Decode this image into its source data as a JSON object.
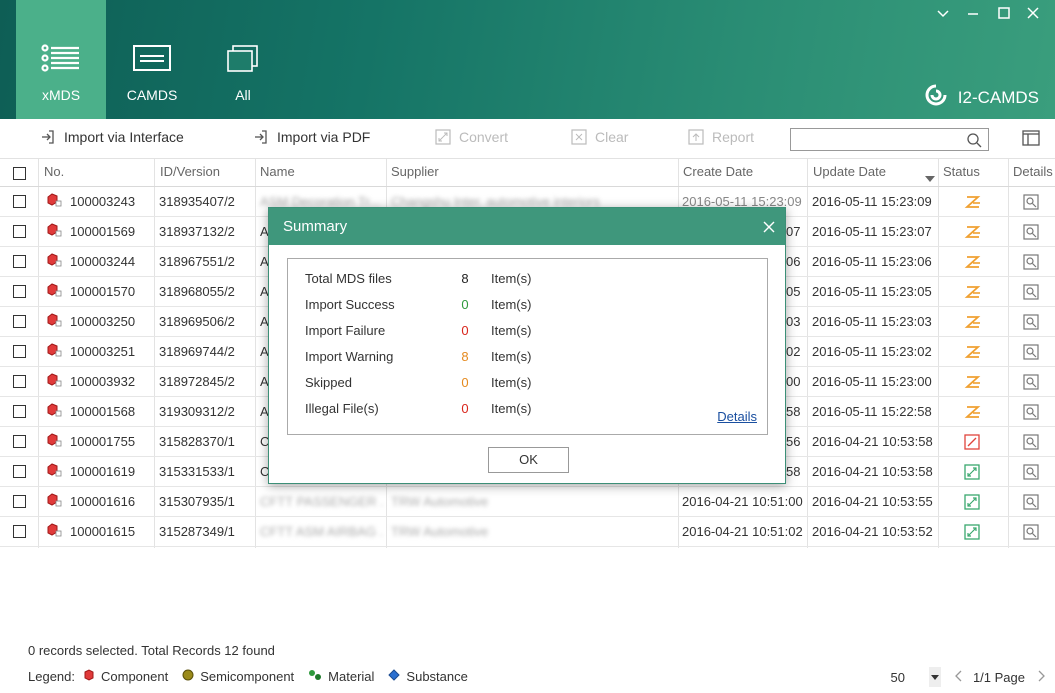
{
  "nav": {
    "tabs": [
      {
        "label": "xMDS",
        "active": true
      },
      {
        "label": "CAMDS",
        "active": false
      },
      {
        "label": "All",
        "active": false
      }
    ],
    "brand": "I2-CAMDS"
  },
  "toolbar": {
    "import_interface": "Import via Interface",
    "import_pdf": "Import via PDF",
    "convert": "Convert",
    "clear": "Clear",
    "report": "Report",
    "search_placeholder": ""
  },
  "table": {
    "headers": {
      "no": "No.",
      "id_version": "ID/Version",
      "name": "Name",
      "supplier": "Supplier",
      "create_date": "Create Date",
      "update_date": "Update Date",
      "status": "Status",
      "details": "Details"
    },
    "rows": [
      {
        "no": "100003243",
        "id": "318935407/2",
        "name": "ASM Decoration Tr...",
        "supplier": "Changshu Inter. automotive interiors",
        "create": "2016-05-11 15:23:09",
        "update": "2016-05-11 15:23:09",
        "status": "warning"
      },
      {
        "no": "100001569",
        "id": "318937132/2",
        "name": "A",
        "supplier": "",
        "create": "07",
        "update": "2016-05-11 15:23:07",
        "status": "warning"
      },
      {
        "no": "100003244",
        "id": "318967551/2",
        "name": "A",
        "supplier": "",
        "create": "06",
        "update": "2016-05-11 15:23:06",
        "status": "warning"
      },
      {
        "no": "100001570",
        "id": "318968055/2",
        "name": "A",
        "supplier": "",
        "create": "05",
        "update": "2016-05-11 15:23:05",
        "status": "warning"
      },
      {
        "no": "100003250",
        "id": "318969506/2",
        "name": "A",
        "supplier": "",
        "create": "03",
        "update": "2016-05-11 15:23:03",
        "status": "warning"
      },
      {
        "no": "100003251",
        "id": "318969744/2",
        "name": "A",
        "supplier": "",
        "create": "02",
        "update": "2016-05-11 15:23:02",
        "status": "warning"
      },
      {
        "no": "100003932",
        "id": "318972845/2",
        "name": "A",
        "supplier": "",
        "create": "00",
        "update": "2016-05-11 15:23:00",
        "status": "warning"
      },
      {
        "no": "100001568",
        "id": "319309312/2",
        "name": "A",
        "supplier": "",
        "create": "58",
        "update": "2016-05-11 15:22:58",
        "status": "warning"
      },
      {
        "no": "100001755",
        "id": "315828370/1",
        "name": "C",
        "supplier": "",
        "create": "56",
        "update": "2016-04-21 10:53:58",
        "status": "error"
      },
      {
        "no": "100001619",
        "id": "315331533/1",
        "name": "C",
        "supplier": "",
        "create": "58",
        "update": "2016-04-21 10:53:58",
        "status": "converted"
      },
      {
        "no": "100001616",
        "id": "315307935/1",
        "name": "CFTT PASSENGER ...",
        "supplier": "TRW Automotive",
        "create": "2016-04-21 10:51:00",
        "update": "2016-04-21 10:53:55",
        "status": "converted"
      },
      {
        "no": "100001615",
        "id": "315287349/1",
        "name": "CFTT ASM AIRBAG ...",
        "supplier": "TRW Automotive",
        "create": "2016-04-21 10:51:02",
        "update": "2016-04-21 10:53:52",
        "status": "converted"
      }
    ]
  },
  "footer": {
    "status": "0 records selected. Total Records 12 found",
    "legend_label": "Legend:",
    "legend": [
      "Component",
      "Semicomponent",
      "Material",
      "Substance"
    ],
    "page_size": "50",
    "page_info": "1/1 Page"
  },
  "modal": {
    "title": "Summary",
    "rows": [
      {
        "label": "Total MDS files",
        "value": "8",
        "unit": "Item(s)",
        "color": "#222222"
      },
      {
        "label": "Import Success",
        "value": "0",
        "unit": "Item(s)",
        "color": "#2e9a3c"
      },
      {
        "label": "Import Failure",
        "value": "0",
        "unit": "Item(s)",
        "color": "#d9261c"
      },
      {
        "label": "Import Warning",
        "value": "8",
        "unit": "Item(s)",
        "color": "#e58a1f"
      },
      {
        "label": "Skipped",
        "value": "0",
        "unit": "Item(s)",
        "color": "#e58a1f"
      },
      {
        "label": "Illegal File(s)",
        "value": "0",
        "unit": "Item(s)",
        "color": "#d9261c"
      }
    ],
    "details_link": "Details",
    "ok": "OK"
  },
  "colors": {
    "accent": "#3f977c",
    "warning": "#f0a030",
    "error": "#e0443c",
    "converted": "#3aa86e"
  }
}
